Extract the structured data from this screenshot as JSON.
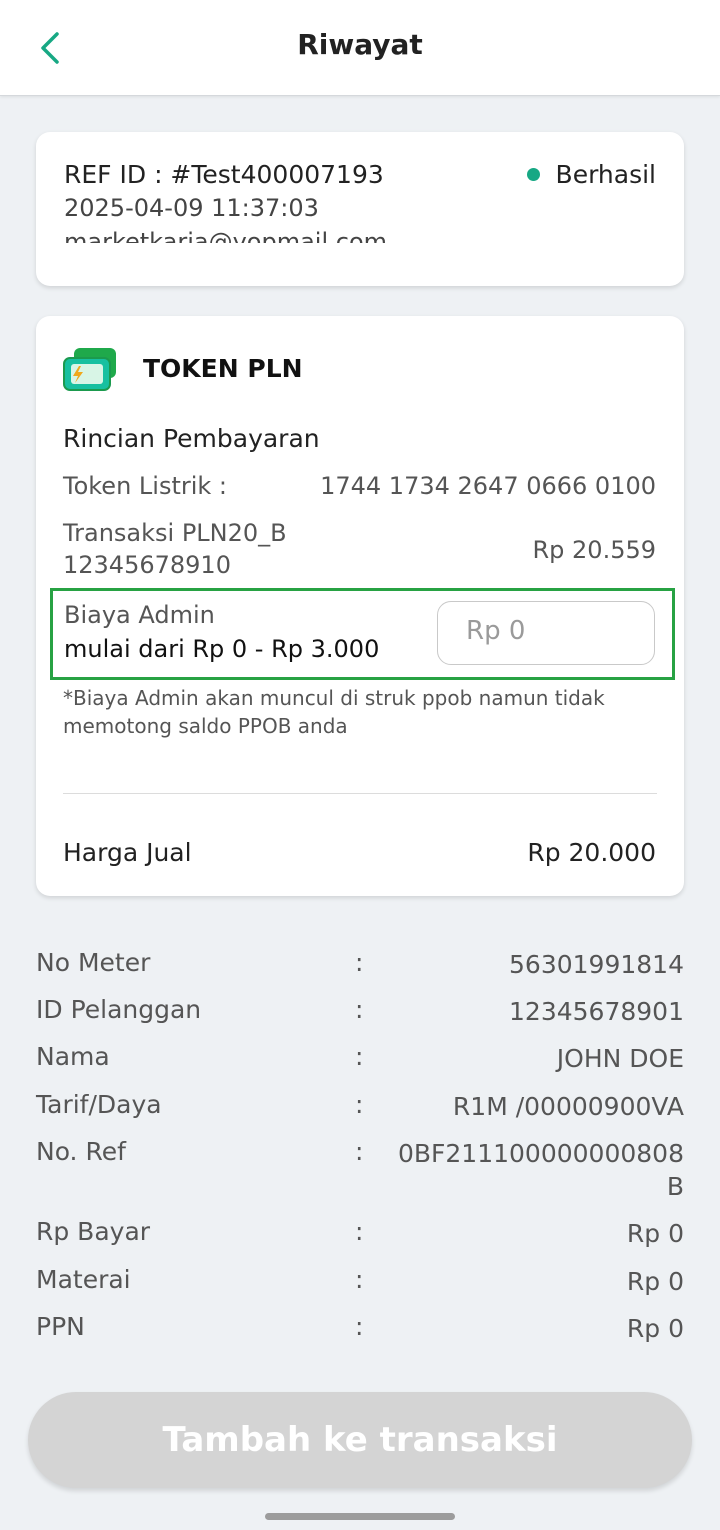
{
  "header": {
    "title": "Riwayat",
    "back_icon": "chevron-left-icon",
    "accent": "#17a884"
  },
  "reference": {
    "ref_id": "REF ID : #Test400007193",
    "date": "2025-04-09 11:37:03",
    "email": "marketkarja@yopmail.com",
    "status_label": "Berhasil",
    "status_color": "#17a884"
  },
  "product": {
    "name": "TOKEN PLN",
    "icon": "electricity-card-icon",
    "section_title": "Rincian Pembayaran",
    "token_label": "Token Listrik :",
    "token_value": "1744 1734 2647 0666 0100",
    "transaction_label_1": "Transaksi PLN20_B",
    "transaction_label_2": "12345678910",
    "transaction_value": "Rp 20.559",
    "admin_fee_label": "Biaya Admin",
    "admin_fee_range": "mulai dari Rp 0 - Rp 3.000",
    "admin_fee_placeholder": "Rp 0",
    "admin_fee_note": "*Biaya Admin akan muncul di struk ppob namun tidak memotong saldo PPOB anda",
    "sale_price_label": "Harga Jual",
    "sale_price_value": "Rp 20.000"
  },
  "details": [
    {
      "label": "No Meter",
      "colon": ":",
      "value": "56301991814"
    },
    {
      "label": "ID Pelanggan",
      "colon": ":",
      "value": "12345678901"
    },
    {
      "label": "Nama",
      "colon": ":",
      "value": "JOHN DOE"
    },
    {
      "label": "Tarif/Daya",
      "colon": ":",
      "value": "R1M /00000900VA"
    },
    {
      "label": "No. Ref",
      "colon": ":",
      "value": "0BF211100000000808\nB"
    },
    {
      "label": "Rp Bayar",
      "colon": ":",
      "value": "Rp 0"
    },
    {
      "label": "Materai",
      "colon": ":",
      "value": "Rp 0"
    },
    {
      "label": "PPN",
      "colon": ":",
      "value": "Rp 0"
    }
  ],
  "action": {
    "add_label": "Tambah ke transaksi"
  }
}
